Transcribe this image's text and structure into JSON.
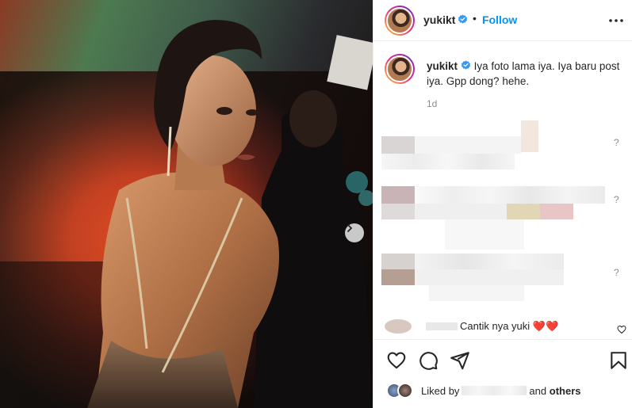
{
  "post": {
    "username": "yukikt",
    "follow_label": "Follow",
    "separator": "•",
    "caption_username": "yukikt",
    "caption_text": "Iya foto lama iya. Iya baru post iya. Gpp dong? hehe.",
    "caption_time": "1d"
  },
  "comments": {
    "last_comment_text": "Cantik nya yuki",
    "last_comment_emoji": "❤️❤️",
    "reply_marker": "?"
  },
  "likes": {
    "prefix": "Liked by",
    "suffix_and": "and",
    "suffix_others": "others"
  },
  "icons": {
    "more": "more-horizontal-icon",
    "like": "heart-outline-icon",
    "comment": "comment-icon",
    "share": "paper-plane-icon",
    "save": "bookmark-icon",
    "next": "chevron-right-icon",
    "verified": "verified-badge-icon"
  },
  "colors": {
    "follow": "#0095f6",
    "verified": "#3897f0",
    "muted": "#8e8e8e",
    "text": "#262626"
  }
}
